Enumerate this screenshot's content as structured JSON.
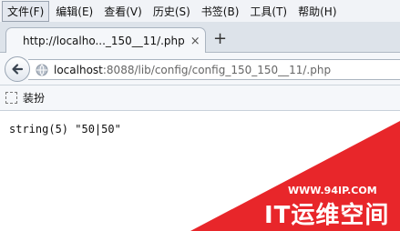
{
  "menubar": {
    "items": [
      "文件(F)",
      "编辑(E)",
      "查看(V)",
      "历史(S)",
      "书签(B)",
      "工具(T)",
      "帮助(H)"
    ]
  },
  "tab": {
    "title": "http://localho..._150__11/.php",
    "close": "×",
    "new_tab": "+"
  },
  "navbar": {
    "url_host": "localhost",
    "url_rest": ":8088/lib/config/config_150_150__11/.php"
  },
  "bookmarks": {
    "label": "装扮"
  },
  "page": {
    "output": "string(5) \"50|50\""
  },
  "watermark": {
    "url": "WWW.94IP.COM",
    "brand": "IT运维空间",
    "color": "#e8262a"
  }
}
